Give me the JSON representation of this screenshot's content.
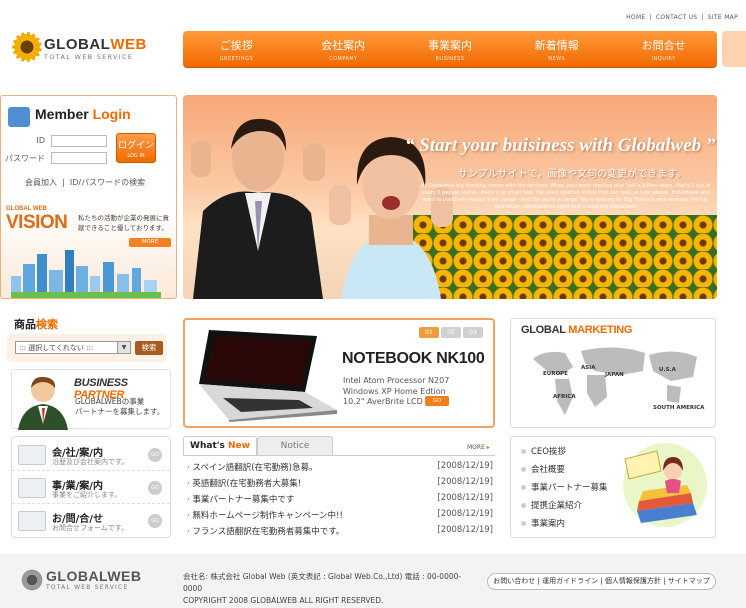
{
  "top_links": [
    "HOME",
    "CONTACT US",
    "SITE MAP"
  ],
  "top_sep": "|",
  "logo": {
    "brand_a": "GLOBAL",
    "brand_b": "WEB",
    "tagline": "TOTAL WEB SERVICE"
  },
  "nav": [
    {
      "jp": "ご挨拶",
      "en": "GREETINGS"
    },
    {
      "jp": "会社案内",
      "en": "COMPANY"
    },
    {
      "jp": "事業案内",
      "en": "BUSINESS"
    },
    {
      "jp": "新着情報",
      "en": "NEWS"
    },
    {
      "jp": "お問合せ",
      "en": "INQUIRY"
    }
  ],
  "login": {
    "title_a": "Member ",
    "title_b": "Login",
    "id_label": "ID",
    "pw_label": "パスワード",
    "button": "ログイン",
    "button_sub": "LOG IN",
    "join": "会員加入",
    "sep": "|",
    "find": "ID/パスワードの検索"
  },
  "vision": {
    "label": "GLOBAL WEB",
    "title": "VISION",
    "desc": "私たちの活動が企業の発展に貢献できること優しております。",
    "more": "MORE"
  },
  "hero": {
    "headline": "“ Start your buisiness with Globalweb ”",
    "sub": "サンプルサイトで，画像や文句の変更ができます。",
    "desc": "At Globalweb big thinking comes with the territory. When your work reaches over half a billion users, that's 1 out of every 2 people online—there's no small task. We need creative minds that can take us new places. Individuals who want to positively impact their career—and the world at large. We're looking for Big Thinkers who embody the fun, innovative, collaborative spirit that's uniquely Globalweb!"
  },
  "search": {
    "title_a": "商品",
    "title_b": "検索",
    "select": "::: 選択してくれない :::",
    "button": "検索"
  },
  "partner": {
    "title_a": "BUSINESS ",
    "title_b": "PARTNER",
    "desc1": "GLOBALWEBの事業",
    "desc2": "パートナーを募集します。"
  },
  "quick": [
    {
      "title": "会/社/案/内",
      "desc": "沿歴及び会社案内です。",
      "go": "GO"
    },
    {
      "title": "事/業/案/内",
      "desc": "事業をご紹介します。",
      "go": "GO"
    },
    {
      "title": "お/問/合/せ",
      "desc": "お問合せフォームです。",
      "go": "GO"
    }
  ],
  "notebook": {
    "pager": [
      "01",
      "02",
      "03"
    ],
    "name": "NOTEBOOK NK100",
    "spec": [
      "Intel Atom Processor N207",
      "Windows XP Home Edtion",
      "10.2\" AverBrite LCD"
    ],
    "go": "GO"
  },
  "news": {
    "tab_new_a": "What's ",
    "tab_new_b": "New",
    "tab_notice": "Notice",
    "more": "MORE",
    "items": [
      {
        "title": "スペイン語翻訳(在宅勤務)急募。",
        "date": "[2008/12/19]"
      },
      {
        "title": "英語翻訳(在宅勤務者大募集!",
        "date": "[2008/12/19]"
      },
      {
        "title": "事業パートナー募集中です",
        "date": "[2008/12/19]"
      },
      {
        "title": "無料ホームページ制作キャンペーン中!!",
        "date": "[2008/12/19]"
      },
      {
        "title": "フランス語翻訳在宅勤務者募集中です。",
        "date": "[2008/12/19]"
      }
    ]
  },
  "marketing": {
    "title_a": "GLOBAL ",
    "title_b": "MARKETING",
    "regions": [
      "EUROPE",
      "ASIA",
      "JAPAN",
      "U.S.A",
      "AFRICA",
      "SOUTH AMERICA"
    ]
  },
  "ceo_links": [
    "CEO挨拶",
    "会社概要",
    "事業パートナー募集",
    "提携企業紹介",
    "事業案内"
  ],
  "footer": {
    "brand": "GLOBALWEB",
    "tagline": "TOTAL WEB SERVICE",
    "addr1": "会社名: 株式会社 Global Web (英文表記 : Global Web.Co.,Ltd)  電話 : 00-0000-0000",
    "addr2": "COPYRIGHT 2008 GLOBALWEB ALL RIGHT RESERVED.",
    "links": "お問い合わせ | 運用ガイドライン | 個人情報保護方針 | サイトマップ"
  },
  "colors": {
    "accent": "#f06a00",
    "nav": "#f47a10"
  }
}
